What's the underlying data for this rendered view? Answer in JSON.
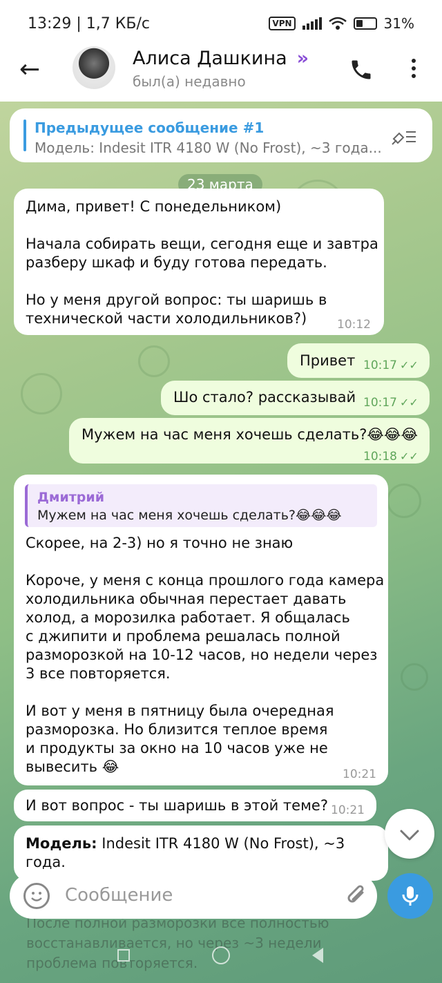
{
  "status_bar": {
    "time": "13:29 | 1,7 КБ/с",
    "vpn": "VPN",
    "battery": "31%"
  },
  "header": {
    "name": "Алиса Дашкина",
    "status": "был(а) недавно",
    "premium_icon": "»"
  },
  "pinned": {
    "title": "Предыдущее сообщение #1",
    "text": "Модель: Indesit ITR 4180 W (No Frost), ~3 года..."
  },
  "date_label": "23 марта",
  "messages": [
    {
      "text": "Дима, привет! С понедельником)",
      "time": ""
    },
    {
      "text": "Начала собирать вещи, сегодня еще и завтра",
      "time": ""
    },
    {
      "text": "разберу шкаф и буду готова передать.",
      "time": ""
    },
    {
      "text": "Но у меня другой вопрос: ты шаришь в",
      "time": ""
    },
    {
      "text": "технической части холодильников?)",
      "time": "10:12"
    },
    {
      "text": "Привет",
      "time": "10:17"
    },
    {
      "text": "Шо стало? рассказывай",
      "time": "10:17"
    },
    {
      "text": "Мужем на час меня хочешь сделать?😂😂😂",
      "time": "10:18"
    },
    {
      "reply_name": "Дмитрий",
      "reply_text": "Мужем на час меня хочешь сделать?😂😂😂"
    },
    {
      "text": "Скорее, на 2-3) но я точно не знаю",
      "time": ""
    },
    {
      "text": "Короче, у меня с конца прошлого года камера",
      "time": ""
    },
    {
      "text": "холодильника обычная перестает давать",
      "time": ""
    },
    {
      "text": "холод, а морозилка работает. Я общалась",
      "time": ""
    },
    {
      "text": "с джипити и проблема решалась полной",
      "time": ""
    },
    {
      "text": "разморозкой на 10-12 часов, но недели через",
      "time": ""
    },
    {
      "text": "3 все повторяется.",
      "time": ""
    },
    {
      "text": "И вот у меня в пятницу была очередная",
      "time": ""
    },
    {
      "text": "разморозка. Но близится теплое время",
      "time": ""
    },
    {
      "text": "и продукты за окно на 10 часов уже не",
      "time": ""
    },
    {
      "text": "вывесить 😂",
      "time": "10:21"
    },
    {
      "text": "И вот вопрос - ты шаришь в этой теме?",
      "time": "10:21"
    },
    {
      "bold": "Модель:",
      "text": " Indesit ITR 4180 W (No Frost), ~3 года."
    }
  ],
  "check_marks": "✓✓",
  "composer": {
    "placeholder": "Сообщение"
  },
  "faded_text": [
    "После полной разморозки все полностью",
    "восстанавливается, но через ~3 недели",
    "проблема повторяется."
  ]
}
